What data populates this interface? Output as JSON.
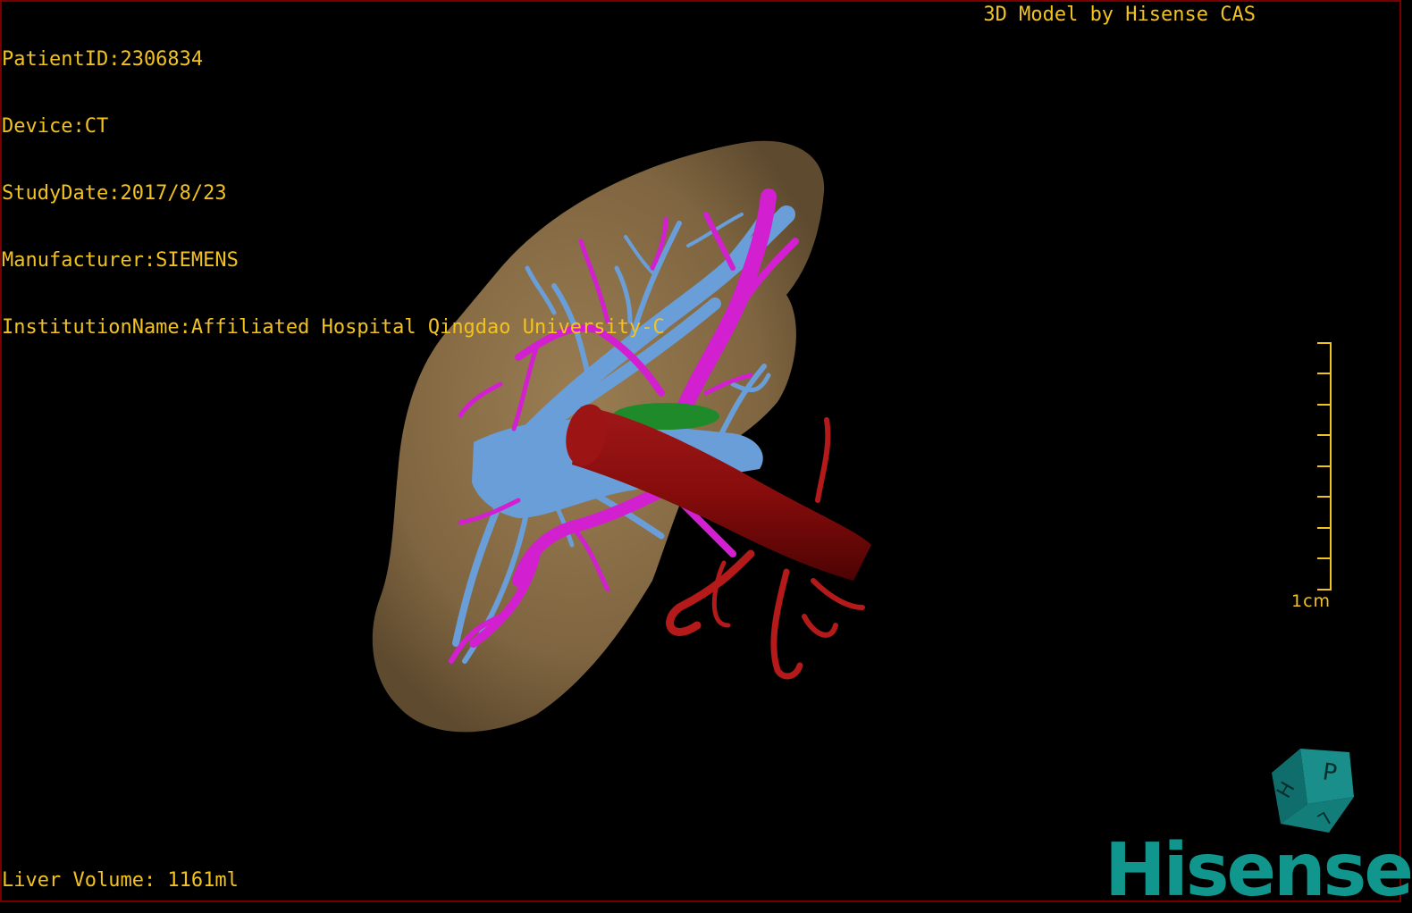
{
  "header": {
    "patient_id": "PatientID:2306834",
    "device": "Device:CT",
    "study_date": "StudyDate:2017/8/23",
    "manufacturer": "Manufacturer:SIEMENS",
    "institution": "InstitutionName:Affiliated Hospital Qingdao University-C"
  },
  "credit": "3D Model by Hisense CAS",
  "footer": {
    "liver_volume": "Liver Volume: 1161ml"
  },
  "scale": {
    "label": "1cm"
  },
  "orientation_cube": {
    "face_labels": [
      "P",
      "H",
      "L"
    ]
  },
  "logo": {
    "text": "Hisense"
  },
  "colors": {
    "overlay_text": "#f2c21f",
    "liver": "#8b7048",
    "hepatic_vein": "#6a9ed8",
    "portal_vein": "#d21fd0",
    "ivc": "#8a0b0b",
    "gallbladder": "#1f8a2a",
    "brand": "#10968d"
  }
}
